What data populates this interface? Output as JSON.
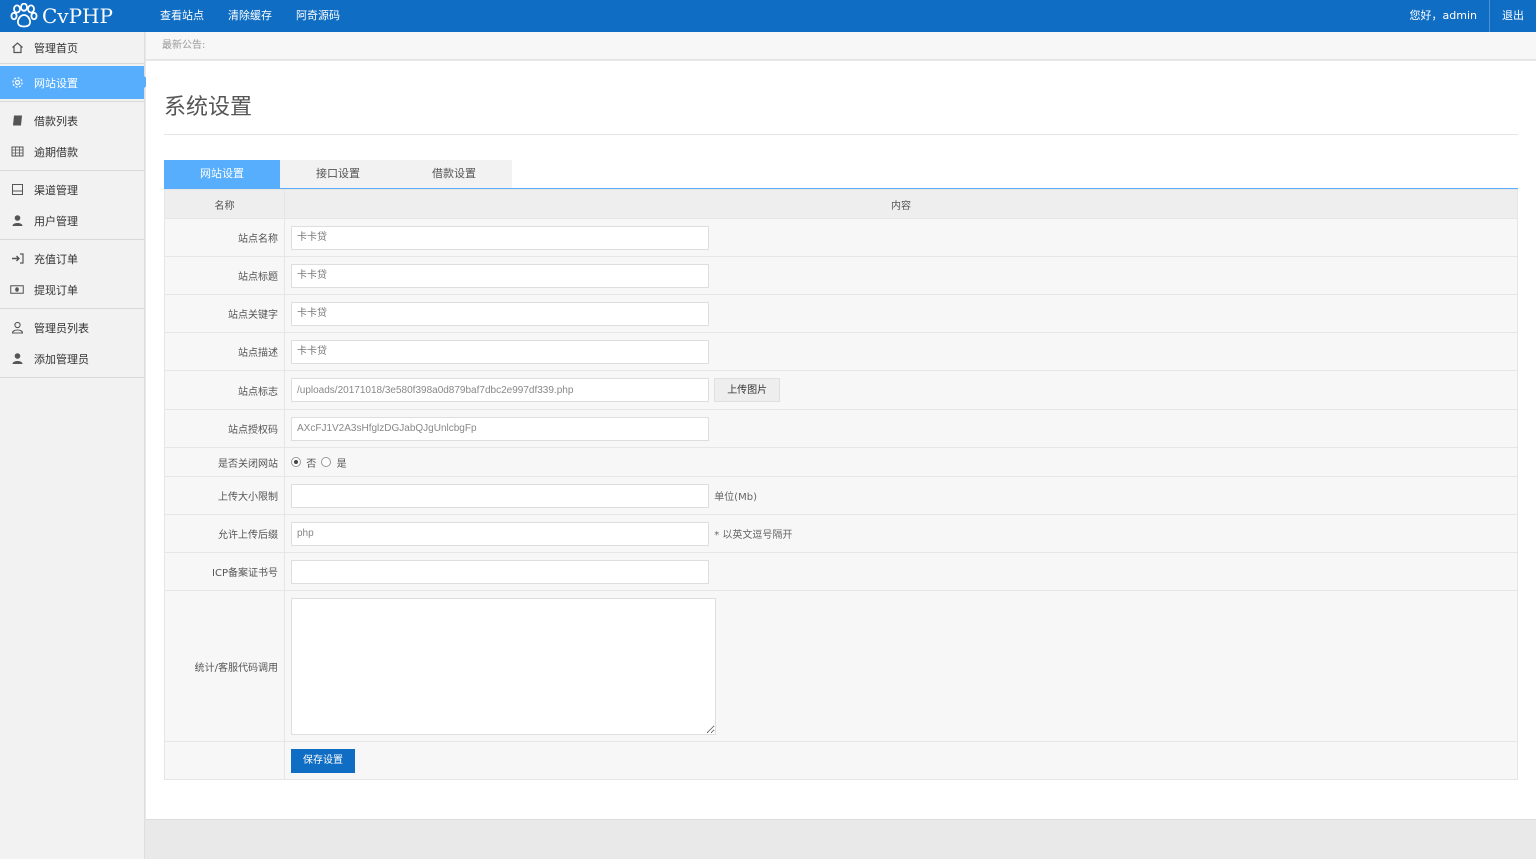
{
  "header": {
    "logo_text": "CvPHP",
    "nav": [
      "查看站点",
      "清除缓存",
      "阿奇源码"
    ],
    "greeting": "您好，admin",
    "logout": "退出"
  },
  "sidebar": {
    "items": [
      {
        "label": "管理首页",
        "icon": "home-icon"
      },
      {
        "label": "网站设置",
        "icon": "gear-icon",
        "active": true
      },
      {
        "label": "借款列表",
        "icon": "book-icon"
      },
      {
        "label": "逾期借款",
        "icon": "table-icon"
      },
      {
        "label": "渠道管理",
        "icon": "window-icon"
      },
      {
        "label": "用户管理",
        "icon": "user-icon"
      },
      {
        "label": "充值订单",
        "icon": "sign-in-icon"
      },
      {
        "label": "提现订单",
        "icon": "money-icon"
      },
      {
        "label": "管理员列表",
        "icon": "user-outline-icon"
      },
      {
        "label": "添加管理员",
        "icon": "user-icon"
      }
    ]
  },
  "notice": "最新公告:",
  "page": {
    "title": "系统设置",
    "tabs": [
      "网站设置",
      "接口设置",
      "借款设置"
    ],
    "active_tab": 0,
    "table_headers": {
      "name": "名称",
      "content": "内容"
    }
  },
  "form": {
    "site_name": {
      "label": "站点名称",
      "placeholder": "卡卡贷"
    },
    "site_title": {
      "label": "站点标题",
      "placeholder": "卡卡贷"
    },
    "site_keywords": {
      "label": "站点关键字",
      "placeholder": "卡卡贷"
    },
    "site_desc": {
      "label": "站点描述",
      "placeholder": "卡卡贷"
    },
    "site_logo": {
      "label": "站点标志",
      "value": "/uploads/20171018/3e580f398a0d879baf7dbc2e997df339.php",
      "button": "上传图片"
    },
    "auth_code": {
      "label": "站点授权码",
      "value": "AXcFJ1V2A3sHfglzDGJabQJgUnlcbgFp"
    },
    "close_site": {
      "label": "是否关闭网站",
      "options": [
        "否",
        "是"
      ],
      "selected": "否"
    },
    "upload_limit": {
      "label": "上传大小限制",
      "value": "",
      "hint": "单位(Mb)"
    },
    "upload_ext": {
      "label": "允许上传后缀",
      "value": "php",
      "hint": "* 以英文逗号隔开"
    },
    "icp": {
      "label": "ICP备案证书号",
      "value": ""
    },
    "stat_code": {
      "label": "统计/客服代码调用",
      "value": ""
    },
    "save_label": "保存设置"
  },
  "colors": {
    "topbar": "#0f6dc4",
    "accent": "#57aefc",
    "save_button": "#0f6dc4"
  }
}
